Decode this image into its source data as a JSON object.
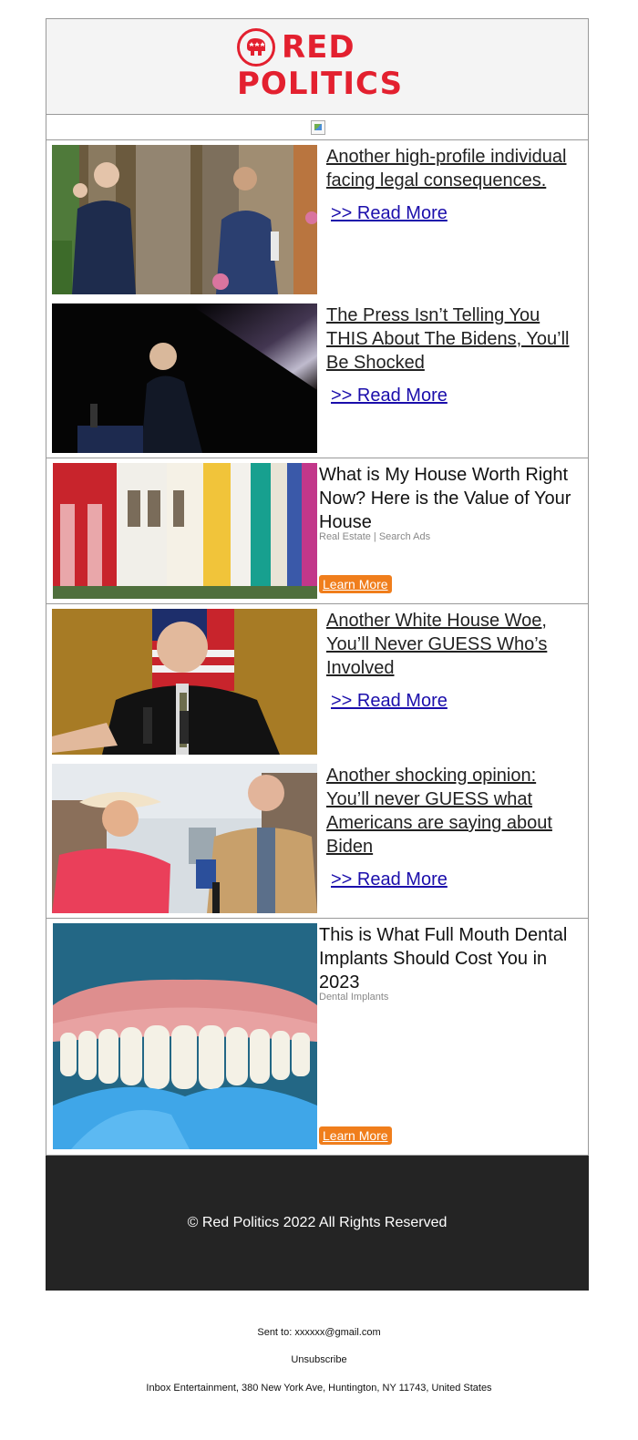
{
  "brand": {
    "name_line1": "RED",
    "name_line2": "POLITICS",
    "seal_icon": "elephant-seal-icon",
    "color": "#e3202f"
  },
  "stories": [
    {
      "headline": "Another high-profile individual facing legal consequences.",
      "cta": ">> Read More"
    },
    {
      "headline": "The Press Isn’t Telling You THIS About The Bidens, You’ll Be Shocked",
      "cta": ">> Read More"
    },
    {
      "headline": "Another White House Woe, You’ll Never GUESS Who’s Involved",
      "cta": ">> Read More"
    },
    {
      "headline": "Another shocking opinion: You’ll never GUESS what Americans are saying about Biden",
      "cta": ">> Read More"
    }
  ],
  "ads": [
    {
      "headline": "What is My House Worth Right Now? Here is the Value of Your House",
      "source": "Real Estate | Search Ads",
      "cta": "Learn More"
    },
    {
      "headline": "This is What Full Mouth Dental Implants Should Cost You in 2023",
      "source": "Dental Implants",
      "cta": "Learn More"
    }
  ],
  "footer": {
    "copyright": "© Red Politics 2022 All Rights Reserved",
    "sent_to": "Sent to: xxxxxx@gmail.com",
    "unsubscribe": "Unsubscribe",
    "address": "Inbox Entertainment, 380 New York Ave, Huntington, NY 11743, United States"
  },
  "colors": {
    "link": "#1a0dab",
    "cta_button": "#f07e1c",
    "footer_bg": "#242424"
  }
}
